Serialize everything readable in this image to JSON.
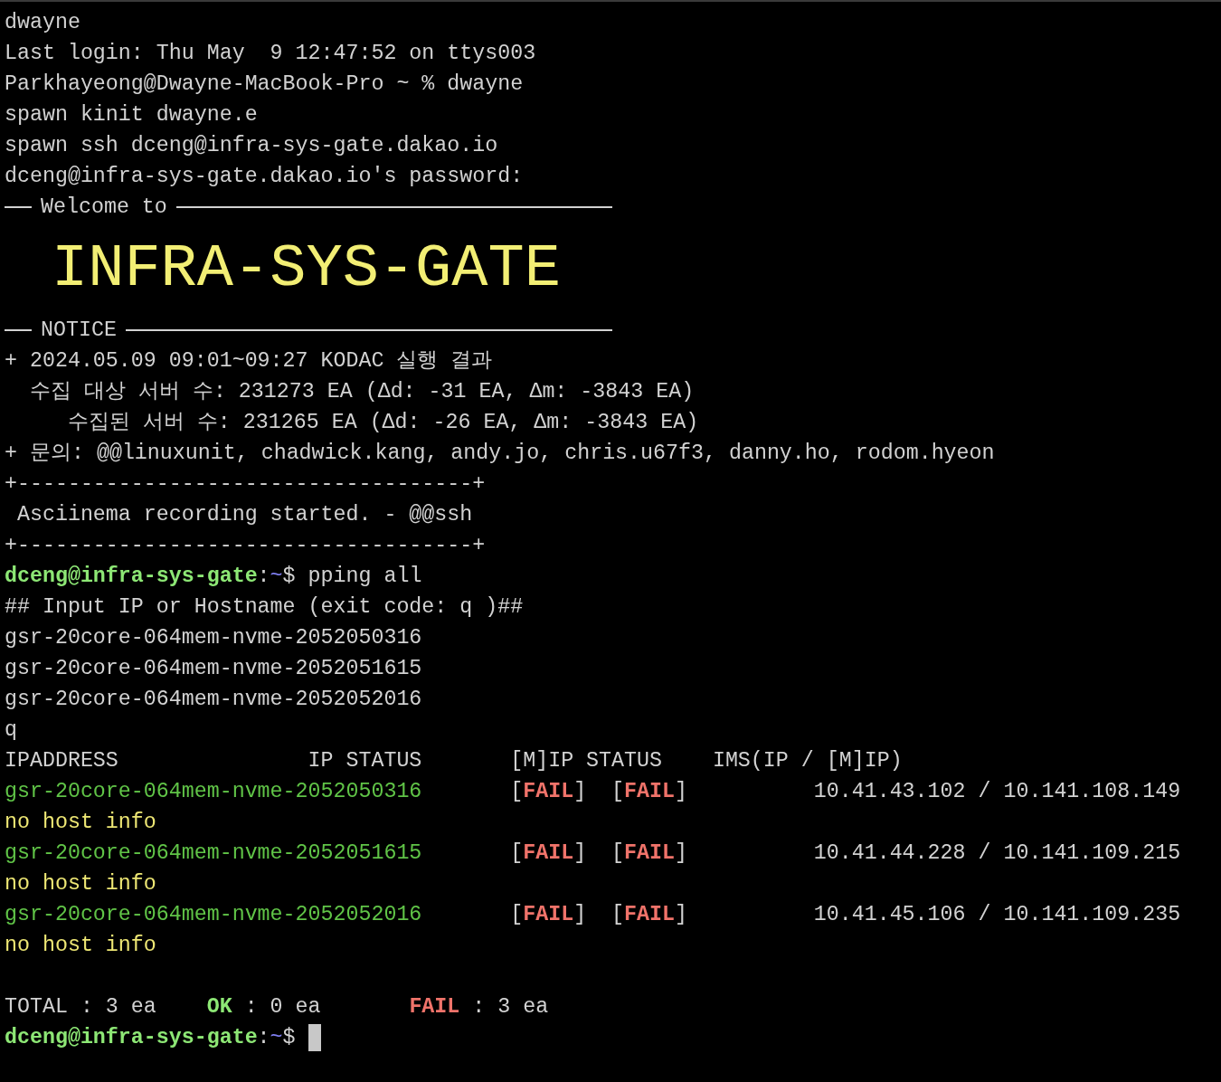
{
  "terminal": {
    "lines": [
      {
        "segments": [
          {
            "kind": "plain",
            "text": "dwayne"
          }
        ]
      },
      {
        "segments": [
          {
            "kind": "plain",
            "text": "Last login: Thu May  9 12:47:52 on ttys003"
          }
        ]
      },
      {
        "segments": [
          {
            "kind": "plain",
            "text": "Parkhayeong@Dwayne-MacBook-Pro ~ % dwayne"
          }
        ]
      },
      {
        "segments": [
          {
            "kind": "plain",
            "text": "spawn kinit dwayne.e"
          }
        ]
      },
      {
        "segments": [
          {
            "kind": "plain",
            "text": "spawn ssh dceng@infra-sys-gate.dakao.io"
          }
        ]
      },
      {
        "segments": [
          {
            "kind": "plain",
            "text": "dceng@infra-sys-gate.dakao.io's password:"
          }
        ]
      },
      {
        "kind": "rule",
        "text": "Welcome to"
      },
      {
        "kind": "banner",
        "text": "INFRA-SYS-GATE"
      },
      {
        "kind": "rule",
        "text": "NOTICE"
      },
      {
        "segments": [
          {
            "kind": "plain",
            "text": "+ 2024.05.09 09:01~09:27 KODAC 실행 결과"
          }
        ]
      },
      {
        "segments": [
          {
            "kind": "plain",
            "text": "  수집 대상 서버 수: 231273 EA (Δd: -31 EA, Δm: -3843 EA)"
          }
        ]
      },
      {
        "segments": [
          {
            "kind": "plain",
            "text": "     수집된 서버 수: 231265 EA (Δd: -26 EA, Δm: -3843 EA)"
          }
        ]
      },
      {
        "segments": [
          {
            "kind": "plain",
            "text": "+ 문의: @@linuxunit, chadwick.kang, andy.jo, chris.u67f3, danny.ho, rodom.hyeon"
          }
        ]
      },
      {
        "segments": [
          {
            "kind": "plain",
            "text": "+------------------------------------+"
          }
        ]
      },
      {
        "segments": [
          {
            "kind": "plain",
            "text": " Asciinema recording started. - @@ssh"
          }
        ]
      },
      {
        "segments": [
          {
            "kind": "plain",
            "text": "+------------------------------------+"
          }
        ]
      },
      {
        "segments": [
          {
            "kind": "user",
            "text": "dceng@infra-sys-gate"
          },
          {
            "kind": "plain",
            "text": ":"
          },
          {
            "kind": "path",
            "text": "~"
          },
          {
            "kind": "plain",
            "text": "$ pping all"
          }
        ]
      },
      {
        "segments": [
          {
            "kind": "plain",
            "text": "## Input IP or Hostname (exit code: q )##"
          }
        ]
      },
      {
        "segments": [
          {
            "kind": "plain",
            "text": "gsr-20core-064mem-nvme-2052050316"
          }
        ]
      },
      {
        "segments": [
          {
            "kind": "plain",
            "text": "gsr-20core-064mem-nvme-2052051615"
          }
        ]
      },
      {
        "segments": [
          {
            "kind": "plain",
            "text": "gsr-20core-064mem-nvme-2052052016"
          }
        ]
      },
      {
        "segments": [
          {
            "kind": "plain",
            "text": "q"
          }
        ]
      },
      {
        "segments": [
          {
            "kind": "plain",
            "text": "IPADDRESS               IP STATUS       [M]IP STATUS    IMS(IP / [M]IP)"
          }
        ]
      },
      {
        "segments": [
          {
            "kind": "host",
            "text": "gsr-20core-064mem-nvme-2052050316"
          },
          {
            "kind": "plain",
            "text": "       ["
          },
          {
            "kind": "fail",
            "text": "FAIL"
          },
          {
            "kind": "plain",
            "text": "]  ["
          },
          {
            "kind": "fail",
            "text": "FAIL"
          },
          {
            "kind": "plain",
            "text": "]          10.41.43.102 / 10.141.108.149"
          }
        ]
      },
      {
        "segments": [
          {
            "kind": "warn",
            "text": "no host info"
          }
        ]
      },
      {
        "segments": [
          {
            "kind": "host",
            "text": "gsr-20core-064mem-nvme-2052051615"
          },
          {
            "kind": "plain",
            "text": "       ["
          },
          {
            "kind": "fail",
            "text": "FAIL"
          },
          {
            "kind": "plain",
            "text": "]  ["
          },
          {
            "kind": "fail",
            "text": "FAIL"
          },
          {
            "kind": "plain",
            "text": "]          10.41.44.228 / 10.141.109.215"
          }
        ]
      },
      {
        "segments": [
          {
            "kind": "warn",
            "text": "no host info"
          }
        ]
      },
      {
        "segments": [
          {
            "kind": "host",
            "text": "gsr-20core-064mem-nvme-2052052016"
          },
          {
            "kind": "plain",
            "text": "       ["
          },
          {
            "kind": "fail",
            "text": "FAIL"
          },
          {
            "kind": "plain",
            "text": "]  ["
          },
          {
            "kind": "fail",
            "text": "FAIL"
          },
          {
            "kind": "plain",
            "text": "]          10.41.45.106 / 10.141.109.235"
          }
        ]
      },
      {
        "segments": [
          {
            "kind": "warn",
            "text": "no host info"
          }
        ]
      },
      {
        "kind": "blank"
      },
      {
        "segments": [
          {
            "kind": "plain",
            "text": "TOTAL : 3 ea    "
          },
          {
            "kind": "ok",
            "text": "OK"
          },
          {
            "kind": "plain",
            "text": " : 0 ea       "
          },
          {
            "kind": "fail",
            "text": "FAIL"
          },
          {
            "kind": "plain",
            "text": " : 3 ea"
          }
        ]
      },
      {
        "segments": [
          {
            "kind": "user",
            "text": "dceng@infra-sys-gate"
          },
          {
            "kind": "plain",
            "text": ":"
          },
          {
            "kind": "path",
            "text": "~"
          },
          {
            "kind": "plain",
            "text": "$ "
          },
          {
            "kind": "cursor"
          }
        ]
      }
    ]
  }
}
